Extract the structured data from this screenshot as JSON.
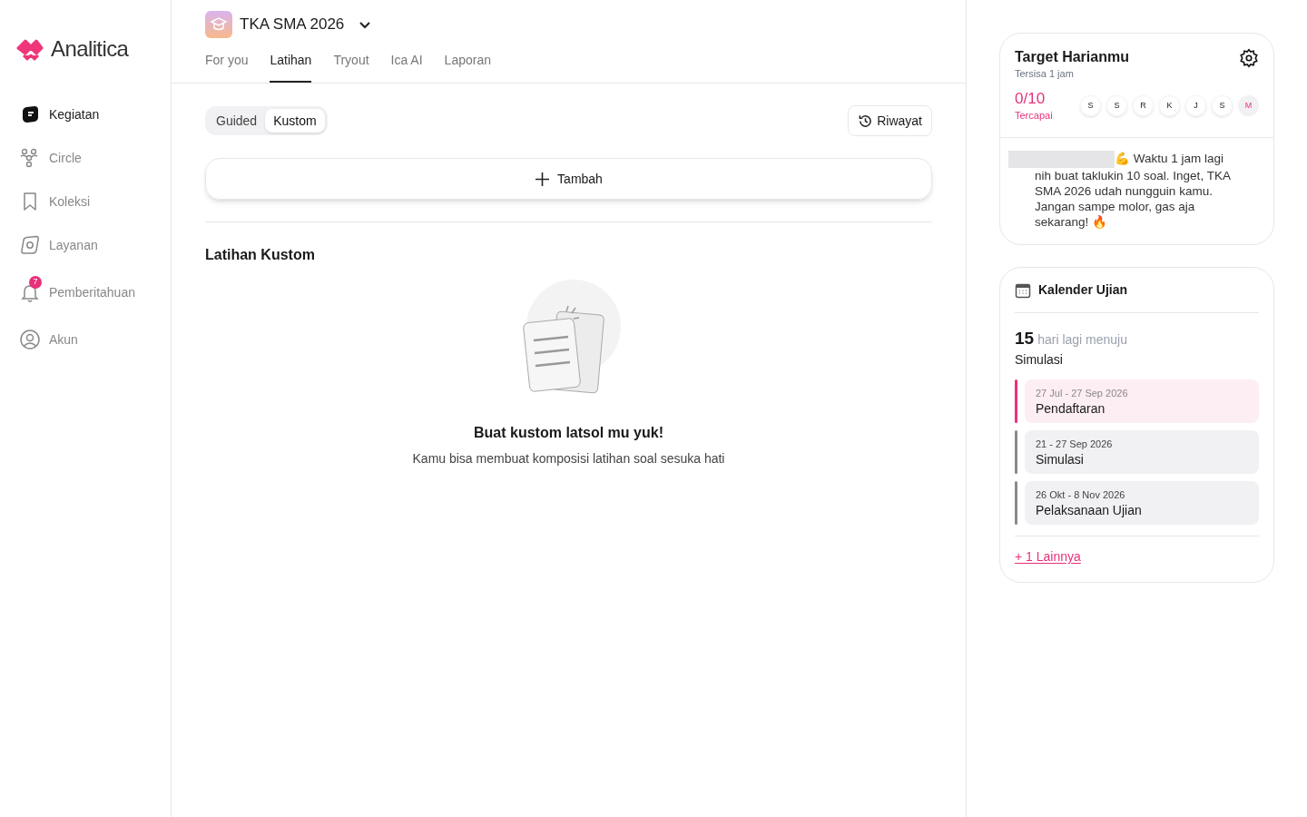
{
  "sidebar": {
    "logo": "Analitica",
    "items": [
      {
        "label": "Kegiatan",
        "selected": true
      },
      {
        "label": "Circle",
        "selected": false
      },
      {
        "label": "Koleksi",
        "selected": false
      },
      {
        "label": "Layanan",
        "selected": false
      },
      {
        "label": "Pemberitahuan",
        "selected": false,
        "badge": "7"
      },
      {
        "label": "Akun",
        "selected": false
      }
    ]
  },
  "header": {
    "course": "TKA SMA 2026"
  },
  "tabs": [
    {
      "label": "For you",
      "selected": false
    },
    {
      "label": "Latihan",
      "selected": true
    },
    {
      "label": "Tryout",
      "selected": false
    },
    {
      "label": "Ica AI",
      "selected": false
    },
    {
      "label": "Laporan",
      "selected": false
    }
  ],
  "segments": [
    {
      "label": "Guided",
      "selected": false
    },
    {
      "label": "Kustom",
      "selected": true
    }
  ],
  "history_button": "Riwayat",
  "add_button": "Tambah",
  "section_title": "Latihan Kustom",
  "empty_state": {
    "title": "Buat kustom latsol mu yuk!",
    "subtitle": "Kamu bisa membuat komposisi latihan soal sesuka hati"
  },
  "target": {
    "title": "Target Harianmu",
    "subtitle": "Tersisa 1 jam",
    "progress": "0/10",
    "progress_label": "Tercapai",
    "days": [
      {
        "label": "S",
        "selected": false
      },
      {
        "label": "S",
        "selected": false
      },
      {
        "label": "R",
        "selected": false
      },
      {
        "label": "K",
        "selected": false
      },
      {
        "label": "J",
        "selected": false
      },
      {
        "label": "S",
        "selected": false
      },
      {
        "label": "M",
        "selected": true
      }
    ],
    "message_start": "💪 Waktu 1 jam lagi",
    "message": "nih buat taklukin 10 soal. Inget, TKA SMA 2026 udah nungguin kamu. Jangan sampe molor, gas aja sekarang! 🔥"
  },
  "calendar": {
    "title": "Kalender Ujian",
    "days_left": "15",
    "days_text": "hari lagi menuju",
    "next_event": "Simulasi",
    "events": [
      {
        "date": "27 Jul - 27 Sep 2026",
        "name": "Pendaftaran",
        "active": true
      },
      {
        "date": "21 - 27 Sep 2026",
        "name": "Simulasi",
        "active": false
      },
      {
        "date": "26 Okt - 8 Nov 2026",
        "name": "Pelaksanaan Ujian",
        "active": false
      }
    ],
    "more_link": "+ 1 Lainnya"
  }
}
